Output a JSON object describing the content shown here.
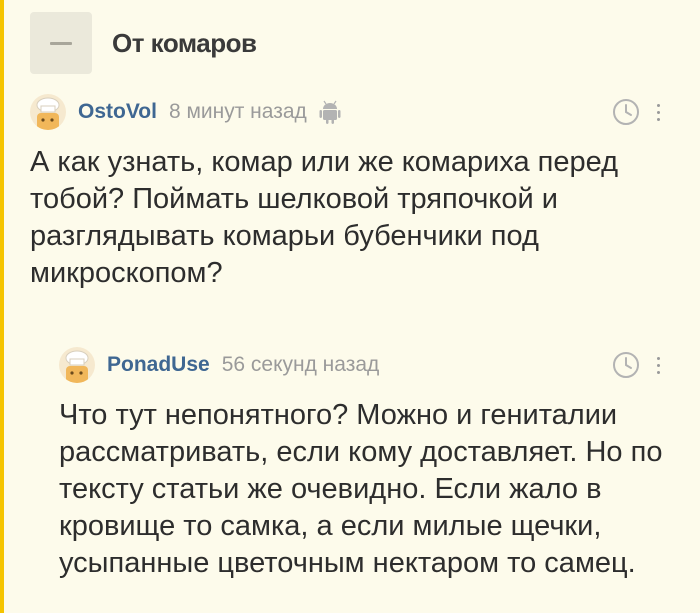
{
  "thread": {
    "title": "От комаров"
  },
  "comments": [
    {
      "author": "OstoVol",
      "time": "8 минут назад",
      "lines": [
        "А как узнать, комар или же комариха перед",
        "тобой? Поймать шелковой тряпочкой и",
        "разглядывать комарьи бубенчики под",
        "микроскопом?"
      ]
    },
    {
      "author": "PonadUse",
      "time": "56 секунд назад",
      "lines": [
        "Что тут непонятного? Можно и гениталии",
        "рассматривать, если кому доставляет. Но по",
        "тексту статьи же очевидно. Если жало в",
        "кровище то самка, а если милые щечки,",
        "усыпанные цветочным нектаром то самец."
      ]
    }
  ]
}
